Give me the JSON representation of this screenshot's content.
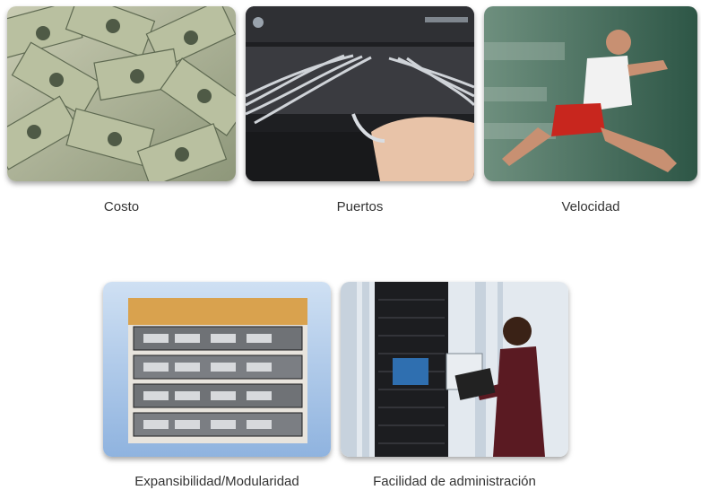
{
  "items": [
    {
      "label": "Costo"
    },
    {
      "label": "Puertos"
    },
    {
      "label": "Velocidad"
    },
    {
      "label": "Expansibilidad/Modularidad"
    },
    {
      "label": "Facilidad de administración"
    }
  ],
  "colors": {
    "money": "#9aa27f",
    "switch": "#2a2a2e",
    "speed_bg": "#3f6b58",
    "router_bg": "#a9c6ea",
    "datacenter_bg": "#dfe6ee"
  }
}
